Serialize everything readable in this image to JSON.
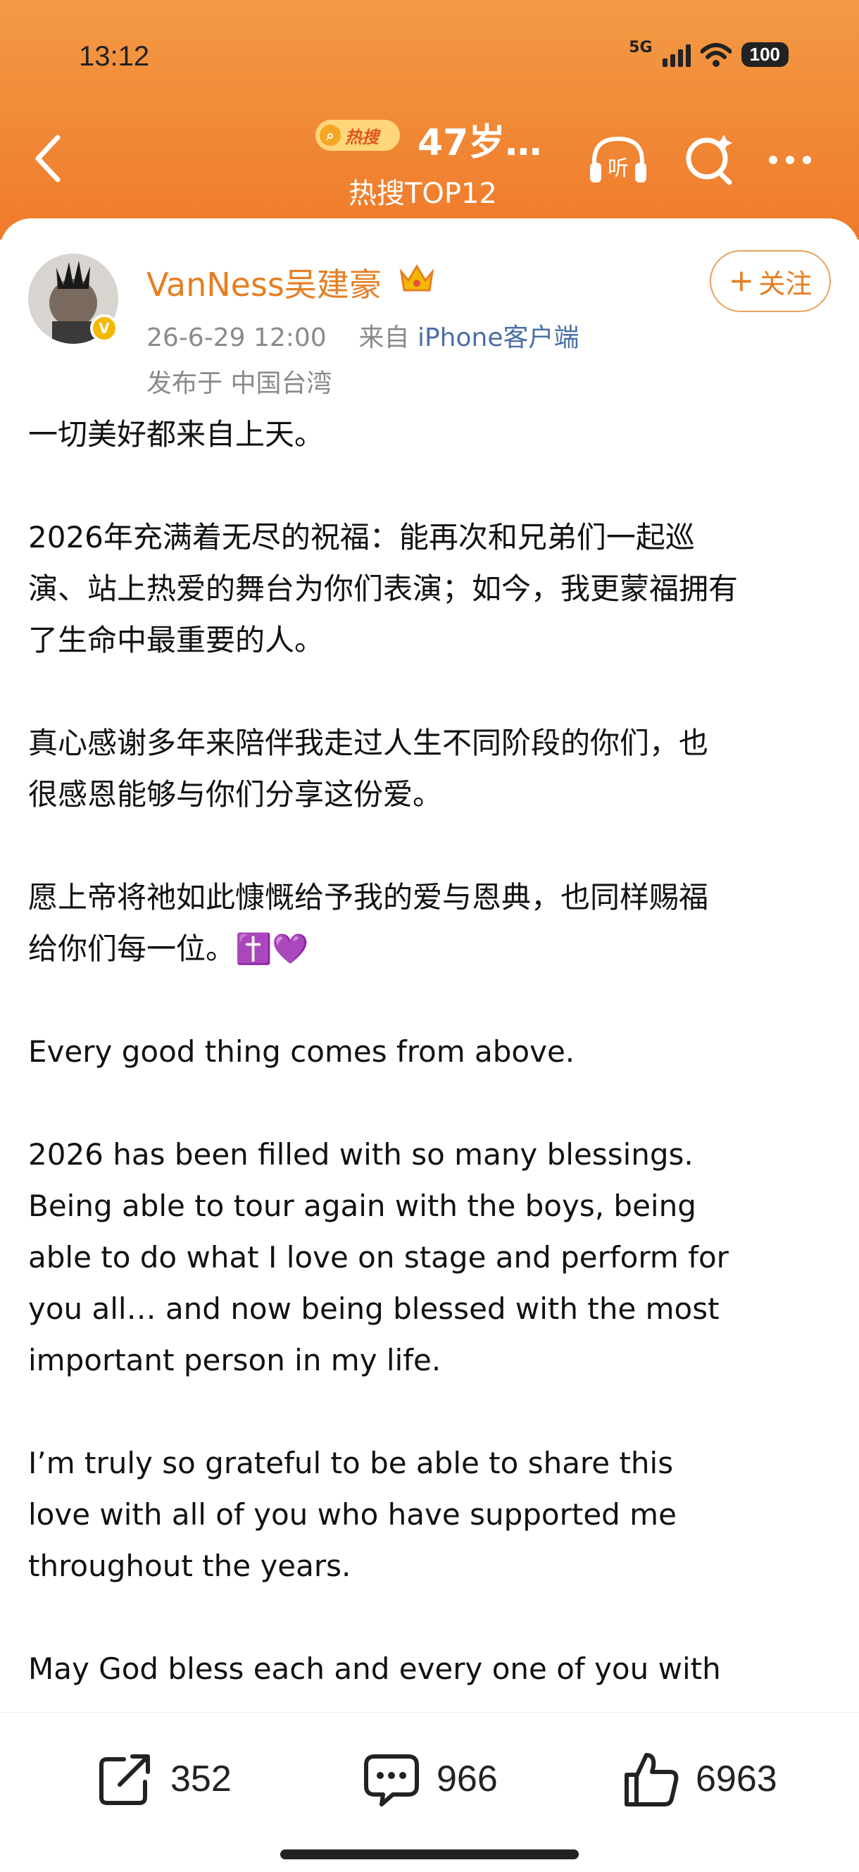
{
  "status_bar": {
    "time": "13:12",
    "network": "5G",
    "battery": "100"
  },
  "nav": {
    "hot_badge": "热搜",
    "title": "47岁…",
    "subtitle": "热搜TOP12",
    "listen_label": "听"
  },
  "post": {
    "user_name": "VanNess吴建豪",
    "timestamp": "26-6-29 12:00",
    "source_prefix": "来自",
    "source_client": "iPhone客户端",
    "location": "发布于 中国台湾",
    "follow_label": "关注",
    "paragraphs": [
      "一切美好都来自上天。",
      "2026年充满着无尽的祝福：能再次和兄弟们一起巡\n演、站上热爱的舞台为你们表演；如今，我更蒙福拥有\n了生命中最重要的人。",
      "真心感谢多年来陪伴我走过人生不同阶段的你们，也\n很感恩能够与你们分享这份爱。",
      "愿上帝将祂如此慷慨给予我的爱与恩典，也同样赐福\n给你们每一位。✝️💜",
      "Every good thing comes from above.",
      "2026 has been filled with so many blessings.\nBeing able to tour again with the boys, being\nable to do what I love on stage and perform for\nyou all… and now being blessed with the most\nimportant person in my life.",
      "I’m truly so grateful to be able to share this\nlove with all of you who have supported me\nthroughout the years.",
      "May God bless each and every one of you with"
    ]
  },
  "actions": {
    "share_count": "352",
    "comment_count": "966",
    "like_count": "6963"
  }
}
